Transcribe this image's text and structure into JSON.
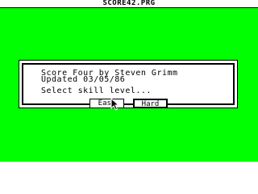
{
  "window": {
    "title": "SCORE42.PRG"
  },
  "dialog": {
    "line1": "Score Four by Steven Grimm",
    "line2": "Updated 03/05/86",
    "prompt": "Select skill level...",
    "buttons": {
      "easy": "Easy",
      "hard": "Hard"
    }
  },
  "colors": {
    "desktop": "#00ff00",
    "dialog": "#ffffff",
    "ink": "#000000"
  },
  "cursor": {
    "icon": "arrow-pointer-icon"
  }
}
